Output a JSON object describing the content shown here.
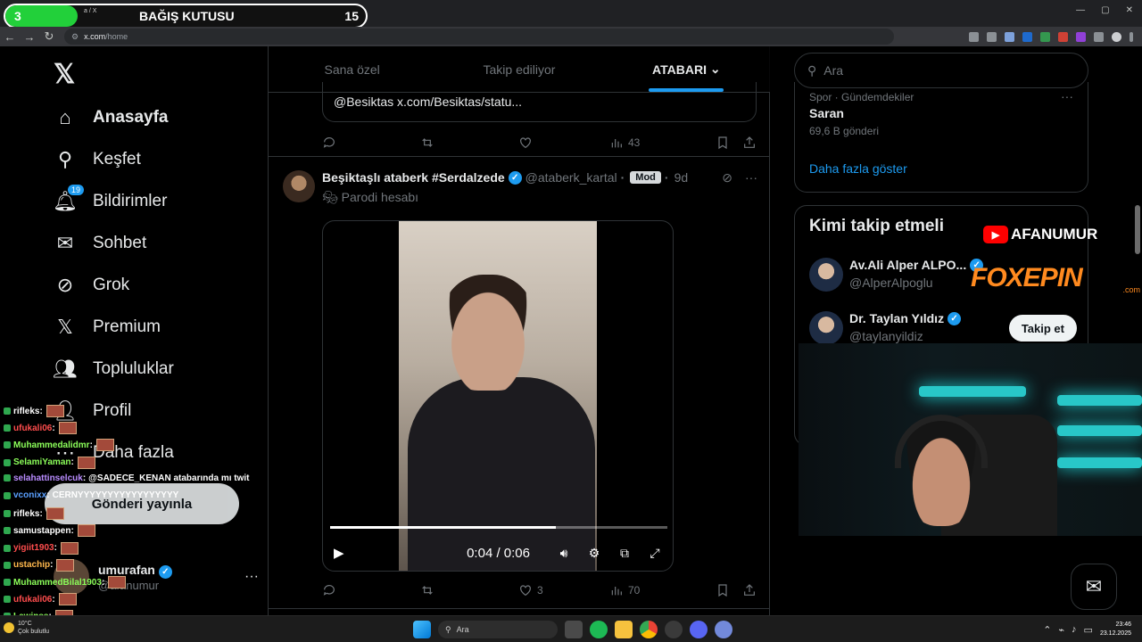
{
  "browser": {
    "url_domain": "x.com",
    "url_path": "/home",
    "tab_partial": "a / X"
  },
  "donation": {
    "left_count": "3",
    "title": "BAĞIŞ KUTUSU",
    "right_count": "15",
    "progress": 0.2
  },
  "nav": {
    "items": [
      {
        "label": "Anasayfa"
      },
      {
        "label": "Keşfet"
      },
      {
        "label": "Bildirimler",
        "badge": "19"
      },
      {
        "label": "Sohbet"
      },
      {
        "label": "Grok"
      },
      {
        "label": "Premium"
      },
      {
        "label": "Topluluklar"
      },
      {
        "label": "Profil"
      },
      {
        "label": "Daha fazla"
      }
    ],
    "post_button": "Gönderi yayınla",
    "profile_name": "umurafan",
    "profile_handle": "@afanumur"
  },
  "chat": [
    {
      "user": "rifleks",
      "color": "#ffffff",
      "msg": ""
    },
    {
      "user": "ufukali06",
      "color": "#ff4d4d",
      "msg": ""
    },
    {
      "user": "Muhammedalidmr",
      "color": "#8cff5a",
      "msg": ""
    },
    {
      "user": "SelamiYaman",
      "color": "#8cff5a",
      "msg": ""
    },
    {
      "user": "selahattinselcuk",
      "color": "#b98cff",
      "msg": "@SADECE_KENAN atabarında mı twit"
    },
    {
      "user": "vconixx",
      "color": "#5aa0ff",
      "msg": "CERNYYYYYYYYYYYYYYYYY"
    },
    {
      "user": "rifleks",
      "color": "#ffffff",
      "msg": ""
    },
    {
      "user": "samustappen",
      "color": "#ffffff",
      "msg": ""
    },
    {
      "user": "yigiit1903",
      "color": "#ff4d4d",
      "msg": ""
    },
    {
      "user": "ustachip",
      "color": "#ffb84d",
      "msg": ""
    },
    {
      "user": "MuhammedBilal1903",
      "color": "#8cff5a",
      "msg": ""
    },
    {
      "user": "ufukali06",
      "color": "#ff4d4d",
      "msg": ""
    },
    {
      "user": "Lewinss",
      "color": "#8cff5a",
      "msg": ""
    }
  ],
  "main": {
    "tabs": [
      "Sana özel",
      "Takip ediliyor",
      "ATABARI"
    ],
    "quote_text": "@Besiktas x.com/Besiktas/statu...",
    "prev_views": "43",
    "tweet": {
      "name": "Beşiktaşlı ataberk #Serdalzede",
      "handle": "@ataberk_kartal",
      "mod": "Mod",
      "time": "9d",
      "sub": "Parodi hesabı",
      "video_time": "0:04 / 0:06",
      "progress": 0.67,
      "likes": "3",
      "views": "70"
    }
  },
  "right": {
    "search_placeholder": "Ara",
    "trend_category": "Spor · Gündemdekiler",
    "trend_name": "Saran",
    "trend_count": "69,6 B gönderi",
    "show_more": "Daha fazla göster",
    "follow_title": "Kimi takip etmeli",
    "follow": [
      {
        "name": "Av.Ali Alper ALPO...",
        "handle": "@AlperAlpoglu"
      },
      {
        "name": "Dr. Taylan Yıldız",
        "handle": "@taylanyildiz",
        "button": "Takip et"
      }
    ]
  },
  "overlays": {
    "yt_brand": "AFANUMUR",
    "fox_brand": "FOXEPIN",
    "fox_suffix": ".com"
  },
  "taskbar": {
    "search": "Ara",
    "time": "23:46",
    "date": "23.12.2025",
    "weather_temp": "10°C",
    "weather_desc": "Çok bulutlu"
  }
}
